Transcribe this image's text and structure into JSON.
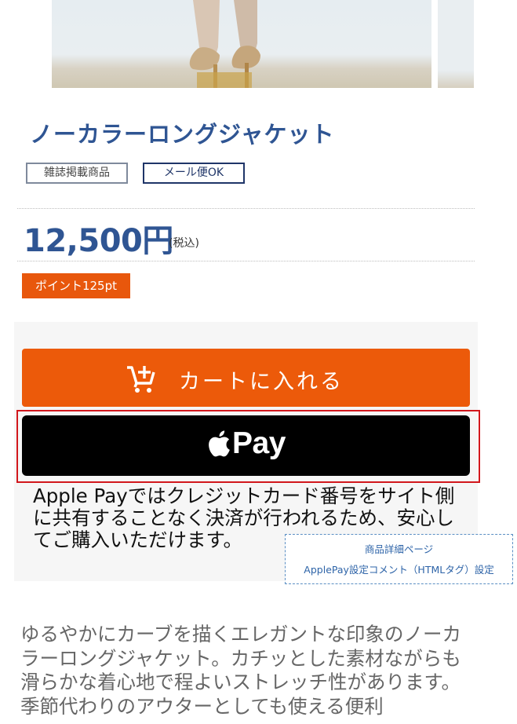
{
  "product": {
    "title": "ノーカラーロングジャケット",
    "tags": [
      "雑誌掲載商品",
      "メール便OK"
    ],
    "price": "12,500円",
    "price_tax": "(税込)",
    "points": "ポイント125pt"
  },
  "cart_button": {
    "label": "カートに入れる",
    "icon": "cart-plus-icon"
  },
  "apple_pay": {
    "label": "Pay",
    "icon": "apple-logo-icon",
    "description": "Apple Payではクレジットカード番号をサイト側に共有することなく決済が行われるため、安心してご購入いただけます。"
  },
  "admin_link": {
    "line1": "商品詳細ページ",
    "line2": "ApplePay設定コメント（HTMLタグ）設定"
  },
  "description": "ゆるやかにカーブを描くエレガントな印象のノーカラーロングジャケット。カチッとした素材ながらも滑らかな着心地で程よいストレッチ性があります。季節代わりのアウターとしても使える便利",
  "colors": {
    "brand_blue": "#2f5593",
    "cart_orange": "#ec5a0a",
    "points_orange": "#e8570c",
    "highlight_red": "#d2171c"
  }
}
